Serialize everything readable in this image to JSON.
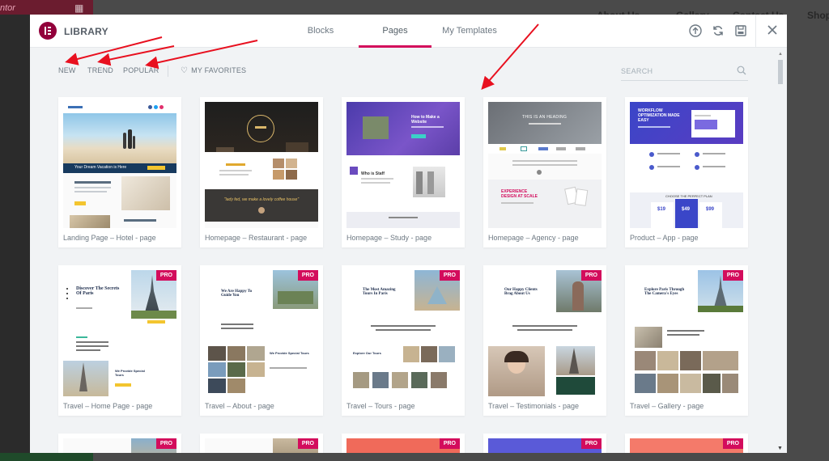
{
  "background": {
    "logo_text": "ntor",
    "nav": [
      "About Us",
      "Gallery",
      "Contact Us",
      "Shop"
    ]
  },
  "library": {
    "title": "LIBRARY",
    "tabs": [
      "Blocks",
      "Pages",
      "My Templates"
    ],
    "active_tab": "Pages"
  },
  "filters": {
    "new": "NEW",
    "trend": "TREND",
    "popular": "POPULAR",
    "favorites": "MY FAVORITES",
    "search_placeholder": "SEARCH"
  },
  "badge_label": "PRO",
  "cards": [
    {
      "title": "Landing Page – Hotel - page",
      "pro": false
    },
    {
      "title": "Homepage – Restaurant - page",
      "pro": false
    },
    {
      "title": "Homepage – Study - page",
      "pro": false
    },
    {
      "title": "Homepage – Agency - page",
      "pro": false
    },
    {
      "title": "Product – App - page",
      "pro": false
    },
    {
      "title": "Travel – Home Page - page",
      "pro": true
    },
    {
      "title": "Travel – About - page",
      "pro": true
    },
    {
      "title": "Travel – Tours - page",
      "pro": true
    },
    {
      "title": "Travel – Testimonials - page",
      "pro": true
    },
    {
      "title": "Travel – Gallery - page",
      "pro": true
    }
  ],
  "thumb_text": {
    "hotel_tagline": "Your Dream Vacation is Here",
    "restaurant_quote": "\"lady fed, we make a lovely coffee house\"",
    "study_heading": "How to Make a Website",
    "study_who": "Who is Staff",
    "agency_heading": "THIS IS AN HEADING",
    "agency_exp": "EXPERIENCE DESIGN AT SCALE",
    "app_heading": "WORKFLOW OPTIMIZATION MADE EASY",
    "app_plan": "CHOOSE THE PERFECT PLAN",
    "app_prices": [
      "$19",
      "$49",
      "$99"
    ],
    "paris_heading": "Discover The Secrets Of Paris",
    "about_heading": "We Are Happy To Guide You",
    "tours_heading": "The Most Amazing Tours In Paris",
    "testimonials_heading": "Our Happy Clients Brag About Us",
    "gallery_heading": "Explore Paris Through The Camera's Eyes"
  },
  "colors": {
    "accent": "#d30c5c",
    "brand": "#92003b",
    "text_muted": "#6d7882",
    "modal_bg": "#f1f3f5",
    "arrow": "#e8101f"
  }
}
